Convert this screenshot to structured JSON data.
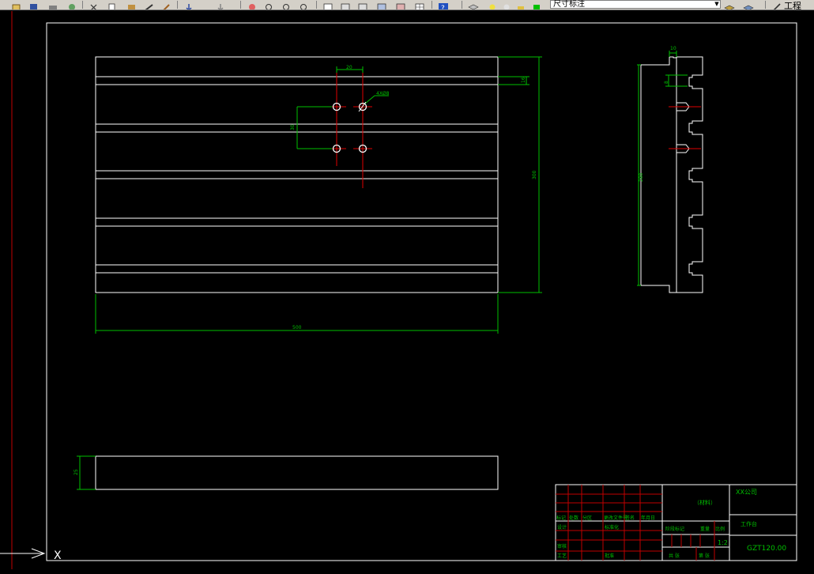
{
  "toolbar": {
    "layer_name": "尺寸标注",
    "right_label": "工程"
  },
  "drawing": {
    "dim_top_width": "20",
    "dim_hole_label": "4XØ8",
    "dim_left_height": "30",
    "dim_right_offset": "16",
    "dim_right_total": "300",
    "dim_bottom_width": "500",
    "dim_side_slot": "10",
    "dim_side_height": "280",
    "dim_side_top": "8",
    "dim_bottom_view_height": "25"
  },
  "ucs": {
    "x_axis": "X"
  },
  "title_block": {
    "material_label": "（材料）",
    "company": "XX公司",
    "part_name": "工作台",
    "drawing_no": "GZT120.00",
    "scale": "1:2",
    "row_labels": [
      "标记",
      "处数",
      "分区",
      "更改文件号",
      "签名",
      "年月日"
    ],
    "design_label": "设计",
    "check_label": "审核",
    "craft_label": "工艺",
    "std_label": "标准化",
    "approve_label": "批准",
    "stage_label": "阶段标记",
    "weight_label": "重量",
    "ratio_label": "比例",
    "sheet_label": "共 张",
    "sheet2_label": "第 张"
  }
}
